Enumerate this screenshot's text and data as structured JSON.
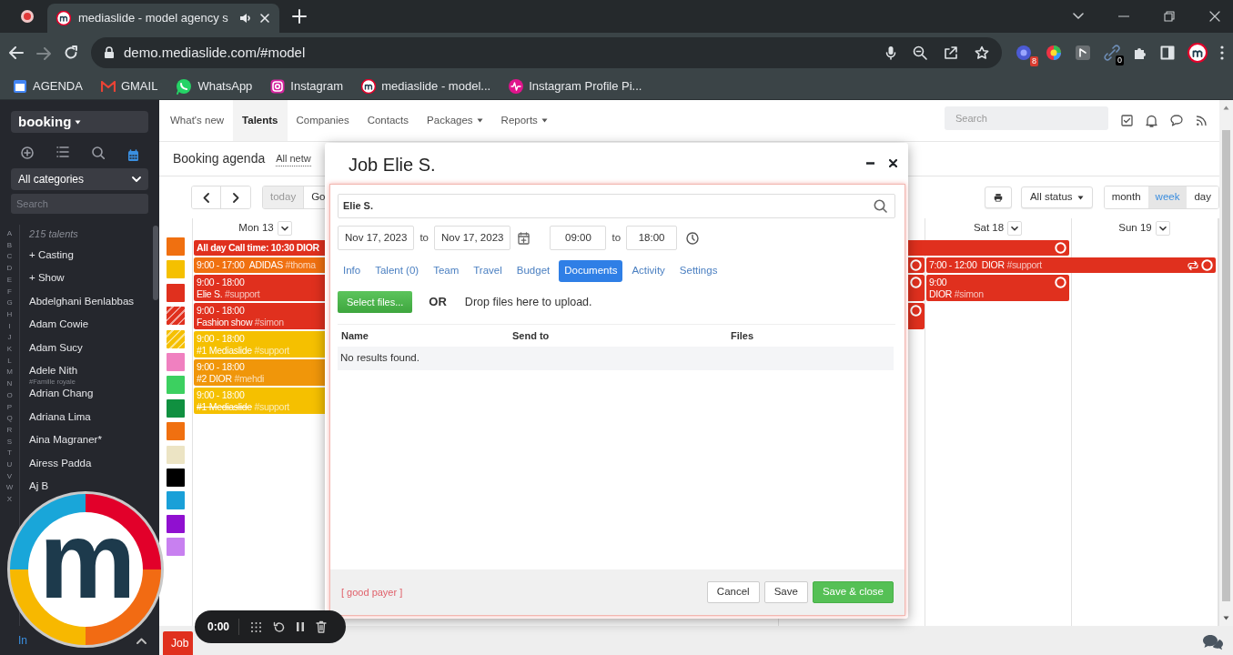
{
  "browser": {
    "tab": {
      "title": "mediaslide - model agency s"
    },
    "address": "demo.mediaslide.com/#model",
    "extension_badges": [
      "8",
      "0"
    ],
    "bookmarks": [
      {
        "label": "AGENDA",
        "kind": "calendar"
      },
      {
        "label": "GMAIL",
        "kind": "mail"
      },
      {
        "label": "WhatsApp",
        "kind": "whatsapp"
      },
      {
        "label": "Instagram",
        "kind": "instagram"
      },
      {
        "label": "mediaslide - model...",
        "kind": "site"
      },
      {
        "label": "Instagram Profile Pi...",
        "kind": "wave"
      }
    ]
  },
  "sidebar": {
    "workspace": "booking",
    "category": "All categories",
    "search": {
      "placeholder": "Search"
    },
    "alphabet": [
      "A",
      "B",
      "C",
      "D",
      "E",
      "F",
      "G",
      "H",
      "I",
      "J",
      "K",
      "L",
      "M",
      "N",
      "O",
      "P",
      "Q",
      "R",
      "S",
      "T",
      "U",
      "V",
      "W",
      "X"
    ],
    "count": "215 talents",
    "items": [
      {
        "label": "+ Casting"
      },
      {
        "label": "+ Show"
      },
      {
        "label": "Abdelghani Benlabbas"
      },
      {
        "label": "Adam Cowie"
      },
      {
        "label": "Adam Sucy"
      },
      {
        "label": "Adele Nith",
        "note": "#Famille royale"
      },
      {
        "label": "Adrian Chang"
      },
      {
        "label": "Adriana Lima"
      },
      {
        "label": "Aina Magraner*"
      },
      {
        "label": "Airess Padda"
      },
      {
        "label": "Aj B"
      }
    ],
    "footer_link": "In"
  },
  "topnav": {
    "tabs": [
      {
        "label": "What's new",
        "selected": false,
        "dropdown": false
      },
      {
        "label": "Talents",
        "selected": true,
        "dropdown": false
      },
      {
        "label": "Companies",
        "selected": false,
        "dropdown": false
      },
      {
        "label": "Contacts",
        "selected": false,
        "dropdown": false
      },
      {
        "label": "Packages",
        "selected": false,
        "dropdown": true
      },
      {
        "label": "Reports",
        "selected": false,
        "dropdown": true
      }
    ],
    "search": {
      "placeholder": "Search"
    }
  },
  "agenda": {
    "title": "Booking agenda",
    "network_filter": "All netw",
    "today": "today",
    "today_disabled": true,
    "goto": "Go",
    "status": "All status",
    "views": [
      {
        "label": "month",
        "selected": false
      },
      {
        "label": "week",
        "selected": true
      },
      {
        "label": "day",
        "selected": false
      }
    ]
  },
  "calendar": {
    "swatches": [
      {
        "color": "#f07010",
        "kind": "solid"
      },
      {
        "color": "#f5c000",
        "kind": "solid"
      },
      {
        "color": "#e0301e",
        "kind": "solid"
      },
      {
        "color": "#e0301e",
        "kind": "striped"
      },
      {
        "color": "#f5c000",
        "kind": "striped"
      },
      {
        "color": "#f080c0",
        "kind": "solid"
      },
      {
        "color": "#3cd060",
        "kind": "solid"
      },
      {
        "color": "#109040",
        "kind": "solid"
      },
      {
        "color": "#f07010",
        "kind": "solid"
      },
      {
        "color": "#ece4c4",
        "kind": "solid"
      },
      {
        "color": "#000000",
        "kind": "solid"
      },
      {
        "color": "#1aa0d8",
        "kind": "solid"
      },
      {
        "color": "#9010d0",
        "kind": "solid"
      },
      {
        "color": "#c880f0",
        "kind": "solid"
      }
    ],
    "monday": {
      "header": "Mon 13",
      "events": [
        {
          "kind": "all-day",
          "title": "All day Call time: 10:30 DIOR",
          "color": "#e0301e"
        },
        {
          "kind": "inline",
          "time": "9:00 - 17:00",
          "title": "ADIDAS",
          "tag": "#thoma",
          "color": "#f07010",
          "cancelled": false
        },
        {
          "kind": "timed",
          "time": "9:00 - 18:00",
          "title": "Elie S.",
          "tag": "#support",
          "color": "#e0301e",
          "cancelled": false
        },
        {
          "kind": "timed",
          "time": "9:00 - 18:00",
          "title": "Fashion show",
          "tag": "#simon",
          "color": "#e0301e",
          "cancelled": false
        },
        {
          "kind": "timed",
          "time": "9:00 - 18:00",
          "title": "#1 Mediaslide",
          "tag": "#support",
          "color": "#f5c000",
          "cancelled": false
        },
        {
          "kind": "timed",
          "time": "9:00 - 18:00",
          "title": "#2 DIOR",
          "tag": "#mehdi",
          "color": "#f0960a",
          "cancelled": false
        },
        {
          "kind": "timed",
          "time": "9:00 - 18:00",
          "title": "#1 Mediaslide",
          "tag": "#support",
          "color": "#f5c000",
          "cancelled": true
        }
      ]
    },
    "friday": {
      "events": [
        {
          "kind": "edge",
          "color": "#e0301e"
        },
        {
          "kind": "edge",
          "color": "#e0301e"
        },
        {
          "kind": "edge",
          "color": "#e0301e"
        }
      ]
    },
    "saturday": {
      "header": "Sat 18",
      "events": [
        {
          "kind": "multi-day",
          "time": "7:00 - 12:00",
          "title": "DIOR",
          "tag": "#support",
          "color": "#e0301e",
          "repeating": true
        },
        {
          "kind": "timed",
          "time": "9:00",
          "title": "DIOR",
          "tag": "#simon",
          "color": "#e0301e"
        }
      ]
    },
    "sunday": {
      "header": "Sun 19"
    }
  },
  "modal": {
    "title": "Job Elie S.",
    "talent_field": {
      "value": "Elie S."
    },
    "start_date": "Nov 17, 2023",
    "date_separator": "to",
    "end_date": "Nov 17, 2023",
    "start_time": "09:00",
    "time_separator": "to",
    "end_time": "18:00",
    "tabs": [
      {
        "label": "Info",
        "selected": false
      },
      {
        "label": "Talent (0)",
        "selected": false
      },
      {
        "label": "Team",
        "selected": false
      },
      {
        "label": "Travel",
        "selected": false
      },
      {
        "label": "Budget",
        "selected": false
      },
      {
        "label": "Documents",
        "selected": true
      },
      {
        "label": "Activity",
        "selected": false
      },
      {
        "label": "Settings",
        "selected": false
      }
    ],
    "upload": {
      "button": "Select files...",
      "or": "OR",
      "hint": "Drop files here to upload."
    },
    "table": {
      "columns": [
        "Name",
        "Send to",
        "Files"
      ],
      "empty_message": "No results found."
    },
    "note": "[ good payer ]",
    "buttons": [
      {
        "label": "Cancel",
        "kind": "default"
      },
      {
        "label": "Save",
        "kind": "default"
      },
      {
        "label": "Save & close",
        "kind": "primary"
      }
    ]
  },
  "bottom_bar": {
    "job_button": "Job"
  },
  "recorder": {
    "time": "0:00"
  },
  "logo_overlay": {
    "letter": "m"
  }
}
